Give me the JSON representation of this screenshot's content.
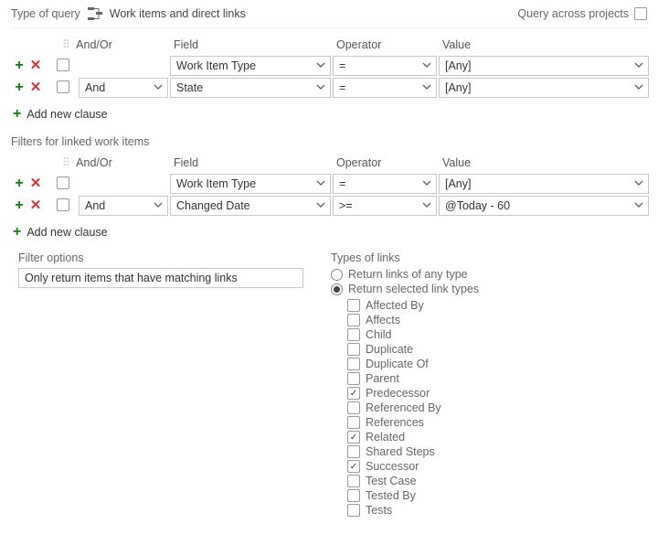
{
  "top": {
    "type_of_query_label": "Type of query",
    "query_type": "Work items and direct links",
    "cross_label": "Query across projects",
    "cross_checked": false
  },
  "headers": {
    "andor": "And/Or",
    "field": "Field",
    "operator": "Operator",
    "value": "Value"
  },
  "top_clauses": [
    {
      "andor": "",
      "field": "Work Item Type",
      "operator": "=",
      "value": "[Any]"
    },
    {
      "andor": "And",
      "field": "State",
      "operator": "=",
      "value": "[Any]"
    }
  ],
  "add_clause_label": "Add new clause",
  "linked_section_title": "Filters for linked work items",
  "linked_clauses": [
    {
      "andor": "",
      "field": "Work Item Type",
      "operator": "=",
      "value": "[Any]"
    },
    {
      "andor": "And",
      "field": "Changed Date",
      "operator": ">=",
      "value": "@Today - 60"
    }
  ],
  "filter_options": {
    "label": "Filter options",
    "value": "Only return items that have matching links"
  },
  "link_types": {
    "label": "Types of links",
    "mode_any": "Return links of any type",
    "mode_selected": "Return selected link types",
    "mode": "selected",
    "items": [
      {
        "label": "Affected By",
        "checked": false
      },
      {
        "label": "Affects",
        "checked": false
      },
      {
        "label": "Child",
        "checked": false
      },
      {
        "label": "Duplicate",
        "checked": false
      },
      {
        "label": "Duplicate Of",
        "checked": false
      },
      {
        "label": "Parent",
        "checked": false
      },
      {
        "label": "Predecessor",
        "checked": true
      },
      {
        "label": "Referenced By",
        "checked": false
      },
      {
        "label": "References",
        "checked": false
      },
      {
        "label": "Related",
        "checked": true
      },
      {
        "label": "Shared Steps",
        "checked": false
      },
      {
        "label": "Successor",
        "checked": true
      },
      {
        "label": "Test Case",
        "checked": false
      },
      {
        "label": "Tested By",
        "checked": false
      },
      {
        "label": "Tests",
        "checked": false
      }
    ]
  }
}
